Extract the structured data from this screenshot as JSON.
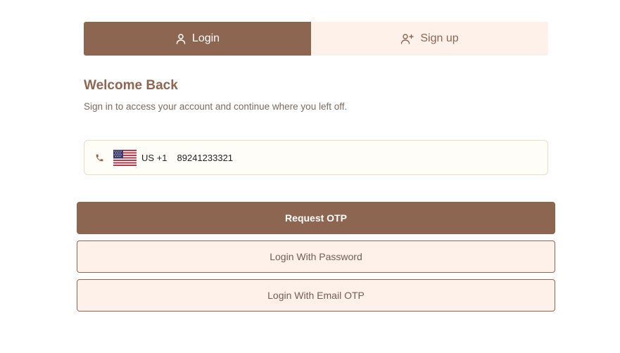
{
  "tabs": {
    "login_label": "Login",
    "signup_label": "Sign up"
  },
  "welcome": {
    "title": "Welcome Back",
    "subtitle": "Sign in to access your account and continue where you left off."
  },
  "phone": {
    "country_code": "US +1",
    "number": "89241233321",
    "flag_icon": "us-flag-icon",
    "phone_icon": "phone-icon"
  },
  "buttons": {
    "request_otp": "Request OTP",
    "login_password": "Login With Password",
    "login_email_otp": "Login With Email OTP"
  },
  "colors": {
    "accent": "#8c6650",
    "accent_light": "#fdf1ea",
    "field_border": "#e6dcc9"
  }
}
